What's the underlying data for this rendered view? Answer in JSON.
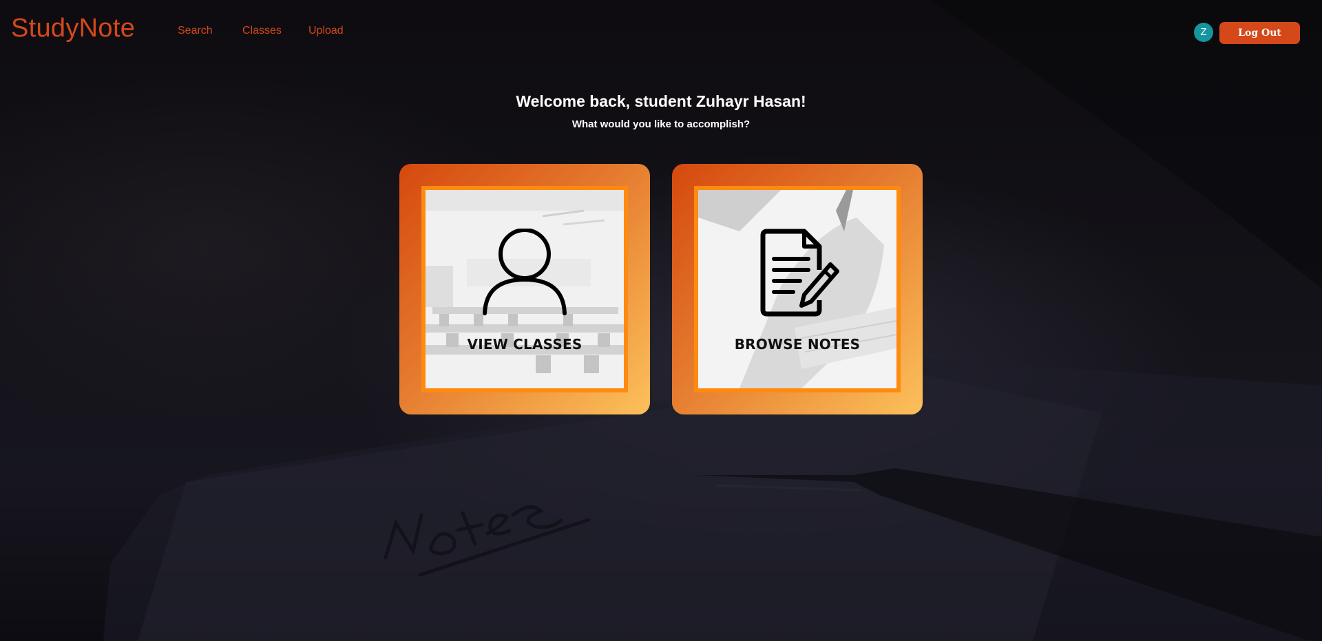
{
  "app": {
    "brand": "StudyNote"
  },
  "nav": {
    "items": [
      {
        "label": "Search"
      },
      {
        "label": "Classes"
      },
      {
        "label": "Upload"
      }
    ]
  },
  "user": {
    "avatar_initial": "Z",
    "logout_label": "Log Out"
  },
  "welcome": {
    "title": "Welcome back, student Zuhayr Hasan!",
    "subtitle": "What would you like to accomplish?"
  },
  "cards": [
    {
      "label": "VIEW CLASSES",
      "icon": "person-icon"
    },
    {
      "label": "BROWSE NOTES",
      "icon": "document-pencil-icon"
    }
  ],
  "colors": {
    "brand": "#d5481a",
    "avatar": "#15959d",
    "card_gradient_start": "#d5490e",
    "card_gradient_end": "#fcc05c",
    "card_border": "#ff8a10"
  }
}
